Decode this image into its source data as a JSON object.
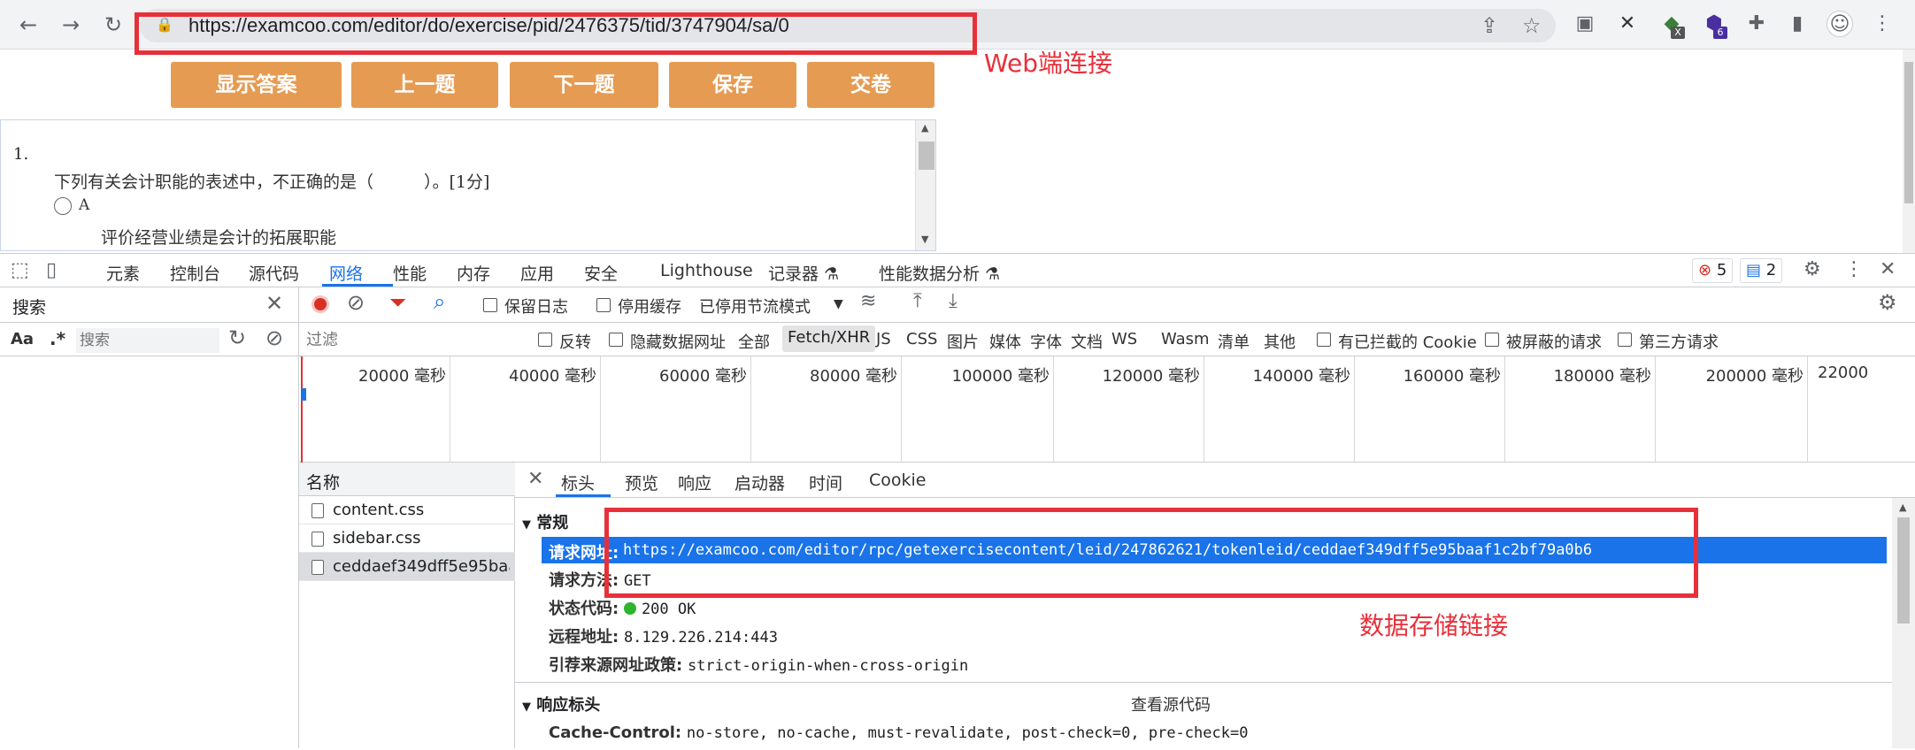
{
  "browser": {
    "back_icon": "arrow-left-icon",
    "forward_icon": "arrow-right-icon",
    "reload_icon": "reload-icon",
    "url": "https://examcoo.com/editor/do/exercise/pid/2476375/tid/3747904/sa/0",
    "ext_badge_x": "X",
    "ext_badge_6": "6"
  },
  "page": {
    "buttons": [
      "显示答案",
      "上一题",
      "下一题",
      "保存",
      "交卷"
    ],
    "question_number": "1.",
    "question_text": "下列有关会计职能的表述中，不正确的是（　　　）。[1分]",
    "option_letter": "A",
    "option_text": "评价经营业绩是会计的拓展职能"
  },
  "devtools": {
    "tabs": [
      "元素",
      "控制台",
      "源代码",
      "网络",
      "性能",
      "内存",
      "应用",
      "安全",
      "Lighthouse",
      "记录器 ⚗",
      "性能数据分析 ⚗"
    ],
    "active_tab": "网络",
    "error_count": "5",
    "message_count": "2",
    "search": {
      "title": "搜索",
      "aa": "Aa",
      "regex": ".*",
      "placeholder": "搜索"
    },
    "toolbar": {
      "preserve_log": "保留日志",
      "disable_cache": "停用缓存",
      "throttle": "已停用节流模式"
    },
    "filter": {
      "placeholder": "过滤",
      "invert": "反转",
      "hide_data_urls": "隐藏数据网址",
      "types": [
        "全部",
        "Fetch/XHR",
        "JS",
        "CSS",
        "图片",
        "媒体",
        "字体",
        "文档",
        "WS",
        "Wasm",
        "清单",
        "其他"
      ],
      "selected_type": "Fetch/XHR",
      "blocked_cookies": "有已拦截的 Cookie",
      "blocked_requests": "被屏蔽的请求",
      "third_party": "第三方请求"
    },
    "timeline_ticks": [
      "20000 毫秒",
      "40000 毫秒",
      "60000 毫秒",
      "80000 毫秒",
      "100000 毫秒",
      "120000 毫秒",
      "140000 毫秒",
      "160000 毫秒",
      "180000 毫秒",
      "200000 毫秒",
      "22000"
    ],
    "requests": {
      "header": "名称",
      "items": [
        "content.css",
        "sidebar.css",
        "ceddaef349dff5e95baa..."
      ]
    },
    "details": {
      "tabs": [
        "标头",
        "预览",
        "响应",
        "启动器",
        "时间",
        "Cookie"
      ],
      "active_tab": "标头",
      "general_title": "常规",
      "request_url_label": "请求网址:",
      "request_url": "https://examcoo.com/editor/rpc/getexercisecontent/leid/247862621/tokenleid/ceddaef349dff5e95baaf1c2bf79a0b6",
      "method_label": "请求方法:",
      "method": "GET",
      "status_label": "状态代码:",
      "status": "200 OK",
      "remote_label": "远程地址:",
      "remote": "8.129.226.214:443",
      "referrer_label": "引荐来源网址政策:",
      "referrer": "strict-origin-when-cross-origin",
      "response_headers_title": "响应标头",
      "view_source": "查看源代码",
      "cache_label": "Cache-Control:",
      "cache": "no-store, no-cache, must-revalidate, post-check=0, pre-check=0"
    }
  },
  "annotations": {
    "web_link": "Web端连接",
    "data_link": "数据存储链接",
    "color": "#e8303a"
  }
}
